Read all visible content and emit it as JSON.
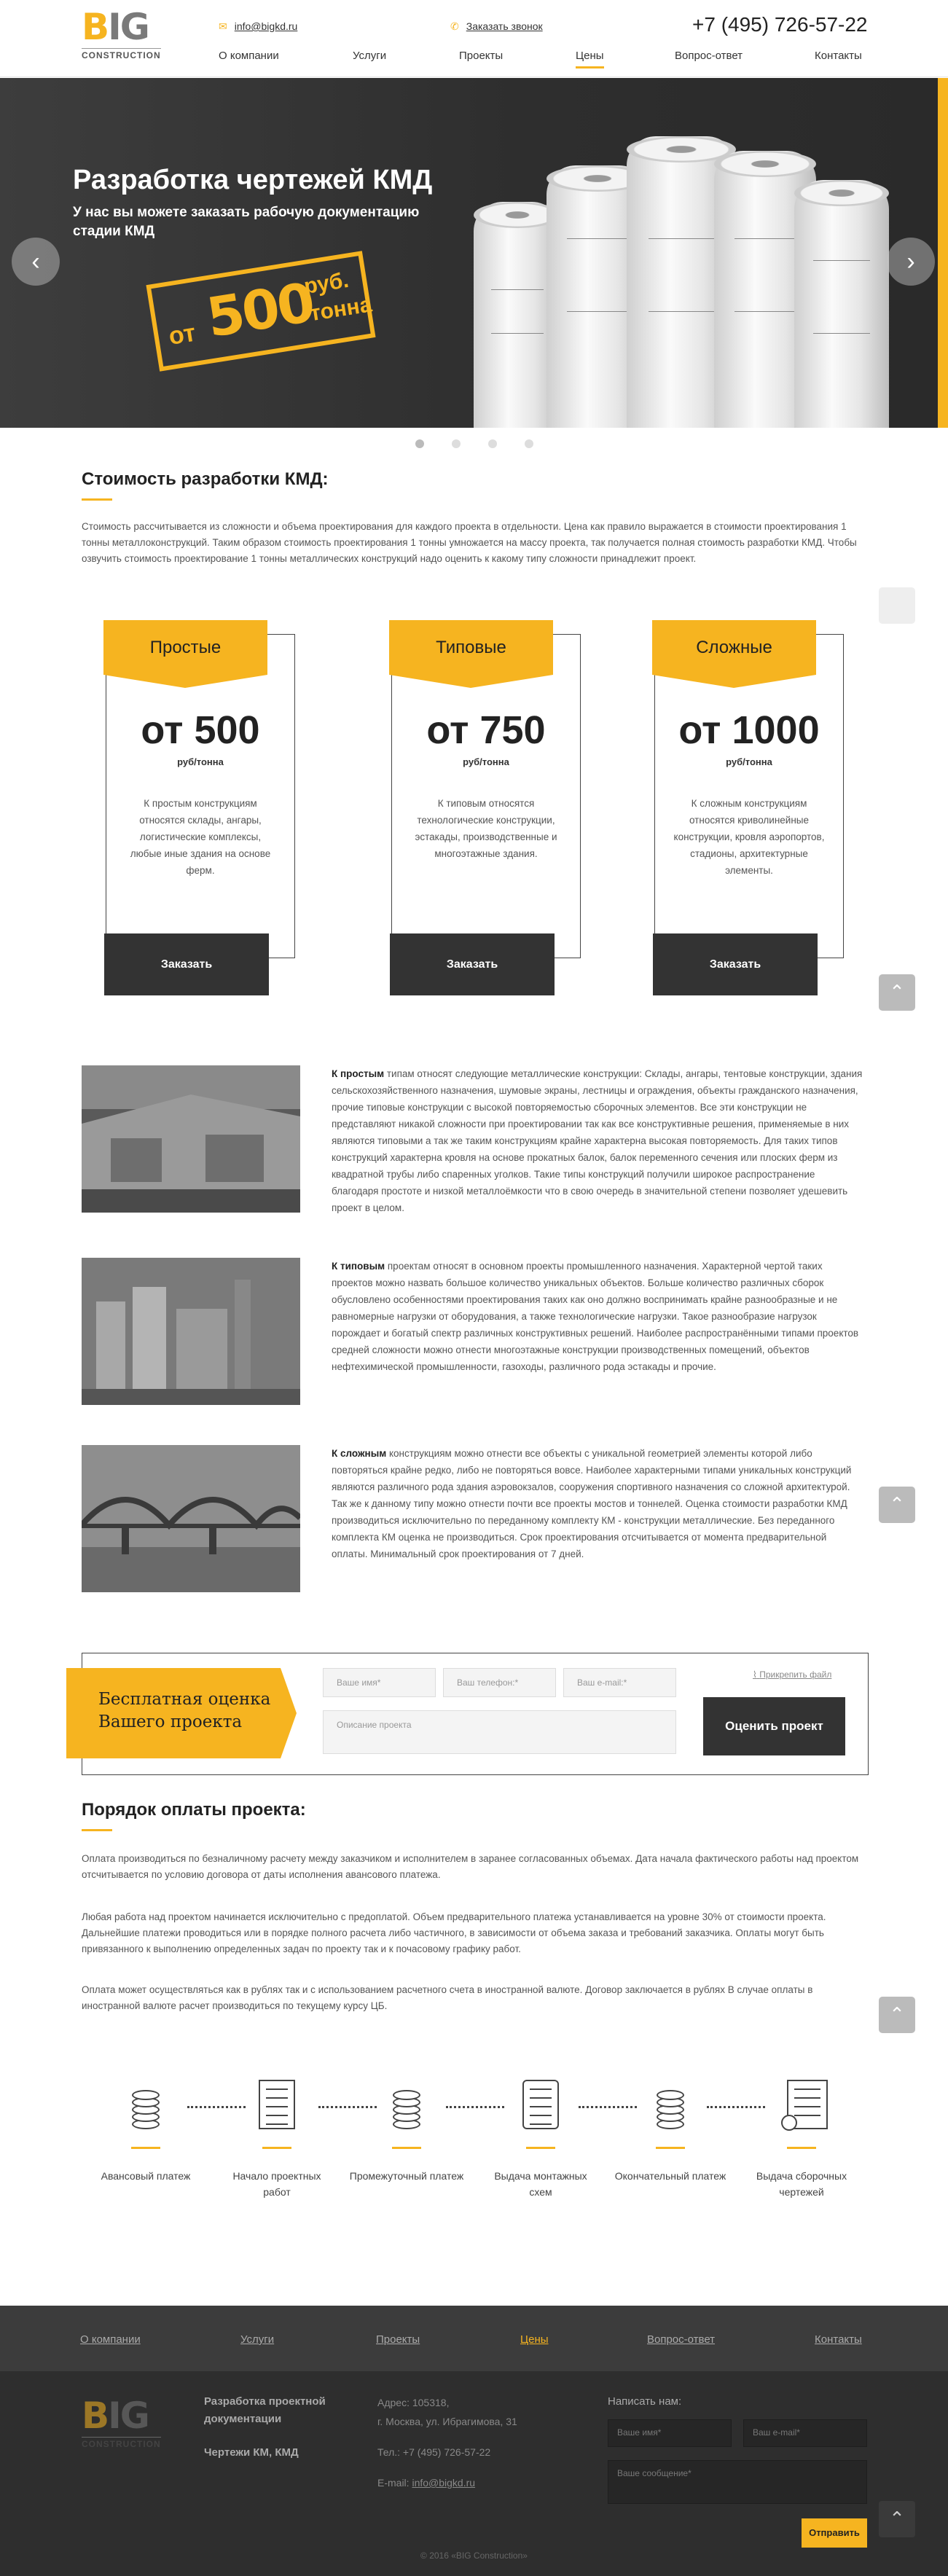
{
  "header": {
    "logo_big": "BIG",
    "logo_sub": "CONSTRUCTION",
    "email": "info@bigkd.ru",
    "callback": "Заказать звонок",
    "phone": "+7 (495) 726-57-22",
    "nav": [
      "О компании",
      "Услуги",
      "Проекты",
      "Цены",
      "Вопрос-ответ",
      "Контакты"
    ],
    "active_nav": "Цены"
  },
  "hero": {
    "title": "Разработка чертежей КМД",
    "subtitle": "У нас вы можете заказать рабочую документацию стадии КМД",
    "stamp_ot": "от",
    "stamp_num": "500",
    "stamp_rub": "руб.",
    "stamp_unit": "тонна",
    "slides": 4,
    "active_slide": 0
  },
  "cost": {
    "title": "Стоимость разработки КМД:",
    "text": "Стоимость рассчитывается из сложности и объема проектирования для каждого проекта в отдельности. Цена как правило выражается в стоимости проектирования 1 тонны металлоконструкций. Таким образом стоимость проектирования 1 тонны умножается на массу проекта, так получается полная стоимость разработки КМД. Чтобы озвучить стоимость проектирование 1 тонны металлических конструкций надо оценить к какому типу сложности принадлежит проект.",
    "cards": [
      {
        "name": "Простые",
        "price": "от 500",
        "unit": "руб/тонна",
        "desc": "К простым конструкциям относятся склады, ангары, логистические комплексы, любые иные здания на основе ферм.",
        "button": "Заказать"
      },
      {
        "name": "Типовые",
        "price": "от 750",
        "unit": "руб/тонна",
        "desc": "К типовым относятся технологические конструкции, эстакады, производственные и многоэтажные здания.",
        "button": "Заказать"
      },
      {
        "name": "Сложные",
        "price": "от 1000",
        "unit": "руб/тонна",
        "desc": "К сложным конструкциям относятся криволинейные конструкции, кровля аэропортов, стадионы, архитектурные элементы.",
        "button": "Заказать"
      }
    ]
  },
  "types": [
    {
      "bold": "К простым",
      "text": " типам относят следующие металлические конструкции: Склады, ангары, тентовые конструкции, здания сельскохозяйственного назначения, шумовые экраны, лестницы и ограждения, объекты гражданского назначения, прочие типовые конструкции с высокой повторяемостью сборочных элементов. Все эти конструкции не представляют никакой сложности при проектировании так как все конструктивные решения, применяемые в них являются типовыми а так же таким конструкциям крайне характерна высокая повторяемость. Для таких типов конструкций характерна кровля на основе прокатных балок, балок переменного сечения или плоских ферм из квадратной трубы либо спаренных уголков. Такие типы конструкций получили широкое распространение благодаря простоте и низкой металлоёмкости что в свою очередь в значительной степени позволяет удешевить проект в целом."
    },
    {
      "bold": "К типовым",
      "text": " проектам относят в основном проекты промышленного назначения. Характерной чертой таких проектов можно назвать большое количество уникальных объектов. Больше количество различных сборок обусловлено особенностями проектирования таких как оно должно воспринимать крайне разнообразные и не равномерные нагрузки от оборудования, а также технологические нагрузки. Такое разнообразие нагрузок порождает и богатый спектр различных конструктивных решений. Наиболее распространёнными типами проектов средней сложности можно отнести многоэтажные конструкции производственных помещений, объектов нефтехимической промышленности, газоходы, различного рода эстакады и прочие."
    },
    {
      "bold": "К сложным",
      "text": " конструкциям можно отнести все объекты с уникальной геометрией элементы которой либо повторяться крайне редко, либо не повторяться вовсе. Наиболее характерными типами уникальных конструкций являются различного рода здания аэровокзалов, сооружения спортивного назначения со сложной архитектурой. Так же к данному типу можно отнести почти все проекты мостов и тоннелей. Оценка стоимости разработки КМД производиться исключительно по переданному комплекту КМ - конструкции металлические. Без переданного комплекта КМ оценка не производиться. Срок проектирования отсчитывается от момента предварительной оплаты. Минимальный срок проектирования от 7 дней."
    }
  ],
  "form": {
    "title_line1": "Бесплатная оценка",
    "title_line2": "Вашего проекта",
    "attach": "Прикрепить файл",
    "name_ph": "Ваше имя*",
    "phone_ph": "Ваш телефон:*",
    "email_ph": "Ваш e-mail:*",
    "desc_ph": "Описание проекта",
    "submit": "Оценить проект"
  },
  "payment": {
    "title": "Порядок оплаты проекта:",
    "p1": "Оплата производиться по безналичному расчету между заказчиком и исполнителем в заранее согласованных объемах. Дата начала фактического работы над проектом отсчитывается по условию договора от даты исполнения авансового платежа.",
    "p2": "Любая работа над проектом начинается исключительно с предоплатой. Объем предварительного платежа устанавливается на уровне 30% от стоимости проекта. Дальнейшие платежи проводиться или в порядке полного расчета либо частичного, в зависимости от объема заказа и требований заказчика. Оплаты могут быть привязанного к выполнению определенных задач по проекту так и к почасовому графику работ.",
    "p3": "Оплата может осуществляться как в рублях так и с использованием расчетного счета в иностранной валюте. Договор заключается в рублях В случае оплаты в иностранной валюте расчет производиться по текущему курсу ЦБ.",
    "steps": [
      {
        "icon": "coins-icon",
        "label": "Авансовый платеж"
      },
      {
        "icon": "document-icon",
        "label": "Начало проектных работ"
      },
      {
        "icon": "coins-icon",
        "label": "Промежуточный платеж"
      },
      {
        "icon": "scroll-icon",
        "label": "Выдача монтажных схем"
      },
      {
        "icon": "coins-icon",
        "label": "Окончательный платеж"
      },
      {
        "icon": "certificate-icon",
        "label": "Выдача сборочных чертежей"
      }
    ]
  },
  "footer": {
    "nav": [
      "О компании",
      "Услуги",
      "Проекты",
      "Цены",
      "Вопрос-ответ",
      "Контакты"
    ],
    "active_nav": "Цены",
    "col1_h": "Разработка проектной документации",
    "col1_sub": "Чертежи КМ, КМД",
    "addr1": "Адрес: 105318,",
    "addr2": "г. Москва, ул. Ибрагимова, 31",
    "tel": "Тел.: +7 (495) 726-57-22",
    "email_label": "E-mail: ",
    "email": "info@bigkd.ru",
    "write_h": "Написать нам:",
    "name_ph": "Ваше имя*",
    "email_ph": "Ваш e-mail*",
    "msg_ph": "Ваше сообщение*",
    "send": "Отправить",
    "copyright": "© 2016 «BIG Construction»"
  },
  "colors": {
    "accent": "#f6b420",
    "dark": "#333333"
  }
}
